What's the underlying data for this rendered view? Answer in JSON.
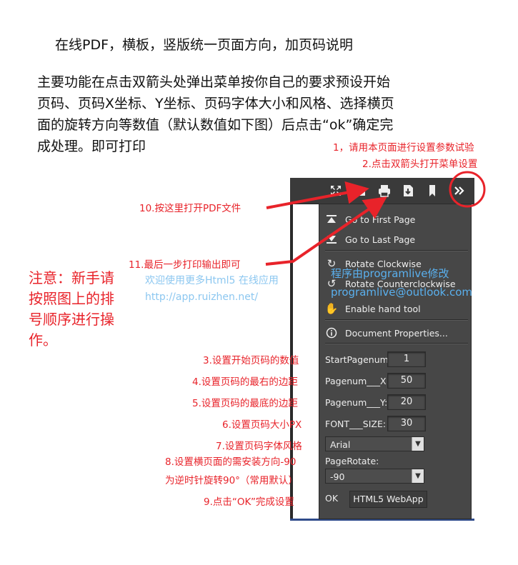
{
  "title": "在线PDF，横板，竖版统一页面方向，加页码说明",
  "description": "主要功能在点击双箭头处弹出菜单按你自己的要求预设开始页码、页码X坐标、Y坐标、页码字体大小和风格、选择横页面的旋转方向等数值（默认数值如下图）后点击“ok”确定完成处理。即可打印",
  "steps": {
    "s1": "1，请用本页面进行设置参数试验",
    "s2": "2.点击双箭头打开菜单设置",
    "s3": "3.设置开始页码的数值",
    "s4": "4.设置页码的最右的边距",
    "s5": "5.设置页码的最底的边距",
    "s6": "6.设置页码大小PX",
    "s7": "7.设置页码字体风格",
    "s8a": "8.设置横页面的需安装方向-90",
    "s8b": "为逆时针旋转90°（常用默认）",
    "s9": "9.点击“OK”完成设置",
    "s10": "10.按这里打开PDF文件",
    "s11": "11.最后一步打印输出即可"
  },
  "note": "注意：新手请按照图上的排号顺序进行操作。",
  "welcome": "欢迎使用更多Html5  在线应用",
  "url": "http://app.ruizhen.net/",
  "byline": "程序由programlive修改",
  "email": "programlive@outlook.com",
  "toolbar_icons": [
    "fullscreen-icon",
    "open-file-icon",
    "print-icon",
    "download-icon",
    "bookmark-icon",
    "double-chevron-icon"
  ],
  "menu": {
    "first_page": "Go to First Page",
    "last_page": "Go to Last Page",
    "rotate_cw": "Rotate Clockwise",
    "rotate_ccw": "Rotate Counterclockwise",
    "hand_tool": "Enable hand tool",
    "doc_props": "Document Properties...",
    "start_label": "StartPagenum:",
    "start_value": "1",
    "x_label": "Pagenum___X:",
    "x_value": "50",
    "y_label": "Pagenum___Y:",
    "y_value": "20",
    "size_label": "FONT___SIZE:",
    "size_value": "30",
    "font_value": "Arial",
    "rotate_label": "PageRotate:",
    "rotate_value": "-90",
    "ok_label": "OK",
    "webapp_label": "HTML5 WebApp"
  },
  "colors": {
    "annotation": "#e8232a",
    "link": "#5ab0ee",
    "menu_bg": "#474747",
    "toolbar_bg": "#3a3a3a"
  }
}
